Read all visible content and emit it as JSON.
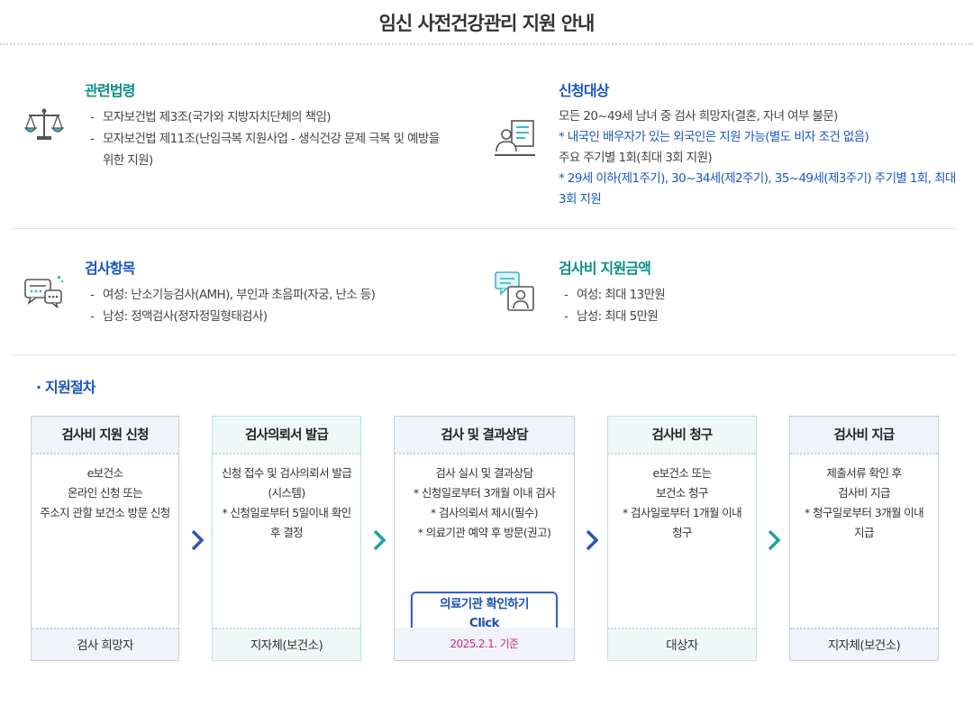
{
  "page": {
    "title": "임신 사전건강관리 지원 안내"
  },
  "colors": {
    "blue_heading": "#1a56c2",
    "teal_heading": "#0b8f86",
    "magenta_date": "#d0267e"
  },
  "law": {
    "heading": "관련법령",
    "icon": "scales-icon",
    "items": [
      "모자보건법 제3조(국가와 지방자치단체의 책임)",
      "모자보건법 제11조(난임극복 지원사업 - 생식건강 문제 극복 및 예방을",
      "위한 지원)"
    ]
  },
  "target": {
    "heading": "신청대상",
    "icon": "applicant-document-icon",
    "lines": [
      "모든 20~49세 남녀 중 검사 희망자(결혼, 자녀 여부 불문)",
      "* 내국인 배우자가 있는 외국인은 지원 가능(별도 비자 조건 없음)",
      "주요 주기별 1회(최대 3회 지원)",
      "* 29세 이하(제1주기), 30~34세(제2주기), 35~49세(제3주기) 주기별 1회, 최대",
      "3회 지원"
    ]
  },
  "tests": {
    "heading": "검사항목",
    "icon": "chat-bubbles-icon",
    "items": [
      "여성: 난소기능검사(AMH), 부인과 초음파(자궁, 난소 등)",
      "남성: 정액검사(정자정밀형태검사)"
    ]
  },
  "support": {
    "heading": "검사비 지원금액",
    "icon": "consult-person-icon",
    "items": [
      "여성: 최대 13만원",
      "남성: 최대 5만원"
    ]
  },
  "procedure": {
    "title": "· 지원절차",
    "steps": [
      {
        "title": "검사비 지원 신청",
        "lines": [
          "e보건소",
          "온라인 신청 또는",
          "주소지 관할 보건소 방문 신청"
        ],
        "footer": "검사 희망자"
      },
      {
        "title": "검사의뢰서 발급",
        "lines": [
          "신청 접수 및 검사의뢰서 발급",
          "(시스템)",
          "* 신청일로부터 5일이내 확인",
          "후 결정"
        ],
        "footer": "지자체(보건소)"
      },
      {
        "title": "검사 및 결과상담",
        "lines": [
          "검사 실시 및 결과상담",
          "* 신청일로부터 3개월 이내 검사",
          "* 검사의뢰서 제시(필수)",
          "* 의료기관 예약 후 방문(권고)"
        ],
        "button_line1": "의료기관 확인하기",
        "button_line2": "Click",
        "footer": "2025.2.1. 기준"
      },
      {
        "title": "검사비 청구",
        "lines": [
          "e보건소 또는",
          "보건소 청구",
          "* 검사일로부터 1개월 이내",
          "청구"
        ],
        "footer": "대상자"
      },
      {
        "title": "검사비 지급",
        "lines": [
          "제출서류 확인 후",
          "검사비 지급",
          "* 청구일로부터 3개월 이내",
          "지급"
        ],
        "footer": "지자체(보건소)"
      }
    ]
  }
}
